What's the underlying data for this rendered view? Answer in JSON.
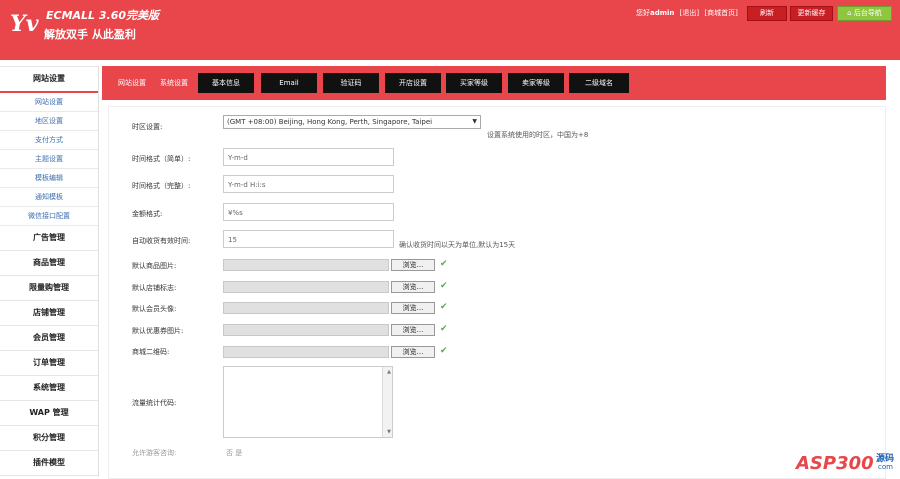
{
  "header": {
    "logo_letters": "Yv",
    "brand_title": "ECMALL 3.60完美版",
    "brand_slogan": "解放双手 从此盈利",
    "greeting_prefix": "您好",
    "username": "admin",
    "logout": "[退出]",
    "mall_home": "[商城首页]",
    "refresh_label": "刷新",
    "update_cache_label": "更新缓存",
    "admin_nav_label": "后台导航"
  },
  "sidebar": {
    "active_section": "网站设置",
    "sub_items": [
      "网站设置",
      "地区设置",
      "支付方式",
      "主题设置",
      "模板编辑",
      "通知模板",
      "微信接口配置"
    ],
    "categories": [
      "广告管理",
      "商品管理",
      "限量购管理",
      "店铺管理",
      "会员管理",
      "订单管理",
      "系统管理",
      "WAP 管理",
      "积分管理",
      "插件模型"
    ]
  },
  "tabbar": {
    "crumb1": "网站设置",
    "crumb2": "系统设置",
    "tabs": [
      "基本信息",
      "Email",
      "验证码",
      "开店设置",
      "买家等级",
      "卖家等级",
      "二级域名"
    ]
  },
  "form": {
    "timezone": {
      "label": "时区设置:",
      "value": "(GMT +08:00) Beijing, Hong Kong, Perth, Singapore, Taipei",
      "hint": "设置系统使用的时区，中国为+8"
    },
    "date_short": {
      "label": "时间格式（简单）:",
      "value": "Y-m-d"
    },
    "date_full": {
      "label": "时间格式（完整）:",
      "value": "Y-m-d H:i:s"
    },
    "price_format": {
      "label": "金额格式:",
      "value": "¥%s"
    },
    "auto_receive": {
      "label": "自动收货有效时间:",
      "value": "15",
      "hint": "确认收货时间以天为单位,默认为15天"
    },
    "browse_label": "浏览...",
    "file_fields": [
      {
        "label": "默认商品图片:"
      },
      {
        "label": "默认店铺标志:"
      },
      {
        "label": "默认会员头像:"
      },
      {
        "label": "默认优惠券图片:"
      },
      {
        "label": "商城二维码:"
      }
    ],
    "stat_code": {
      "label": "流量统计代码:"
    },
    "bottom_partial": {
      "label": "允许游客咨询:",
      "options": "否 是"
    }
  },
  "watermark": {
    "text": "ASP300",
    "sub": "源码",
    "domain": "com"
  },
  "colors": {
    "header_red": "#e8464b",
    "tab_black": "#111111",
    "check_green": "#4caf50",
    "link_blue": "#3b6db0"
  }
}
